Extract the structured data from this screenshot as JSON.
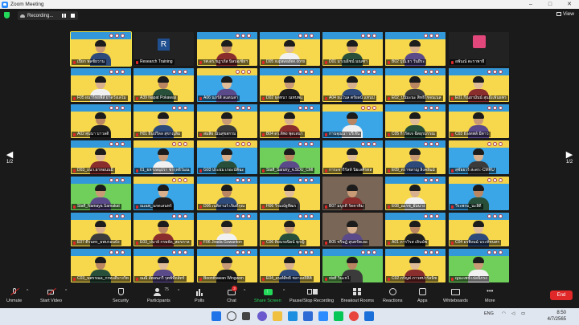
{
  "window": {
    "title": "Zoom Meeting",
    "minimize": "–",
    "maximize": "□",
    "close": "✕"
  },
  "top": {
    "recording_label": "Recording...",
    "view_label": "View"
  },
  "pager": {
    "left": "1/2",
    "right": "1/2"
  },
  "tiles": [
    [
      "เปียก พลชัยวาน",
      "Research Training",
      "รศ.ดร.ชฎาภัส นิลบ่อ/ชัยฯ",
      "D05 supawadee.oons",
      "D01 มาเนธิชน์ มณฑา",
      "B02 ปุณิ.ยา วันยีระ",
      "อพันณ์ ตะราพายี"
    ],
    [
      "F05 ผนาร์ทยพีส์ ยาดวังเลไม",
      "A39 Napat Pokawas",
      "A06 นภรัส์ ลแดนลา",
      "D02 ธุตทนา ณหบพแ",
      "A04 ยแไนล ตรัยลนั้ แทนป",
      "E02_ปนิมะนะ สิทธิไขจนเนล",
      "E01 กีณยามันน์ สุนยัเเพ็นธพร"
    ],
    [
      "A02 ศุมนา บาวลดิ",
      "H01 ฝีนปรีลล สุขาญลิ่ม",
      "สมสิย ณินสุขสกรม",
      "B04 ดร.ดิพ่ง พุดเลนา",
      "กานจุณนา บรีเจีน",
      "C05 กิ์วรัตเจ ฉีตผุรมรรณ",
      "C03 ยังงดพล์ มีตาว"
    ],
    [
      "D03_ถนา.ยาทอนนมี",
      "01_ยหาเษนุปรา ชรรุทธิ์ในณ",
      "G03 ประยม เกอะนั่ติฉะ",
      "Staff_Saruny_จ.SDU_CMI",
      "การะจารีรัลท์ นิยเลศิรทล",
      "E09_ดราชลาญ ลิงคลิมม์",
      "สุชัยยวร์ สะดร:-CMRU"
    ],
    [
      "Staff_Namaya Samakat",
      "ณเฉพ_นกดเลนทร์",
      "D06 เนติสานร์ เจิมดีกุณ",
      "H06 วีรมณ์ฐทีฒร",
      "B07 มนูรดี รัดคาติม",
      "E08_ฌเรช_ยัมนาง",
      "วีระพรบ_นะลีดี"
    ],
    [
      "E07 ตีรนทร_ยพบรอนบัง",
      "E03_ปนาย์ กรษจัด_สมรภาล",
      "F06 Jirada Gowanton",
      "C06 ทิยนรยนิยน์ พุกญิ",
      "B05 ชริษฎ์ สุนทรัตเลอ",
      "A01 ภารวิรส เดินน์ซ",
      "C04 อรพิงนน์ นระท์ชนทร"
    ],
    [
      "C03_นพรรณอ_กรทะดีบางวิท",
      "ณณี สัตลนภวี รุตพ์ที่ถล์ทร์",
      "Boonthawan Wingwon",
      "E04_ดนพ์สิทธิ์ ชลาลงถึคิติ",
      "staff วินะหไ",
      "C02 ภรัญค่ ภาวศปวรัลนิช",
      "ญนะเพช์ เปลนิกรง"
    ]
  ],
  "toolbar": {
    "unmute": "Unmute",
    "start_video": "Start Video",
    "security": "Security",
    "participants": "Participants",
    "participants_count": "75",
    "polls": "Polls",
    "chat": "Chat",
    "chat_badge": "3",
    "share_screen": "Share Screen",
    "pause_stop": "Pause/Stop Recording",
    "breakout": "Breakout Rooms",
    "reactions": "Reactions",
    "apps": "Apps",
    "whiteboards": "Whiteboards",
    "more": "More",
    "end": "End"
  },
  "taskbar": {
    "time": "8:50",
    "date": "4/7/2565",
    "lang": "ENG",
    "lang2": "TH"
  },
  "colors": {
    "zoom_blue": "#2d8cff",
    "end_red": "#e02828",
    "share_green": "#23d959",
    "active_speaker": "#f3e94b"
  }
}
